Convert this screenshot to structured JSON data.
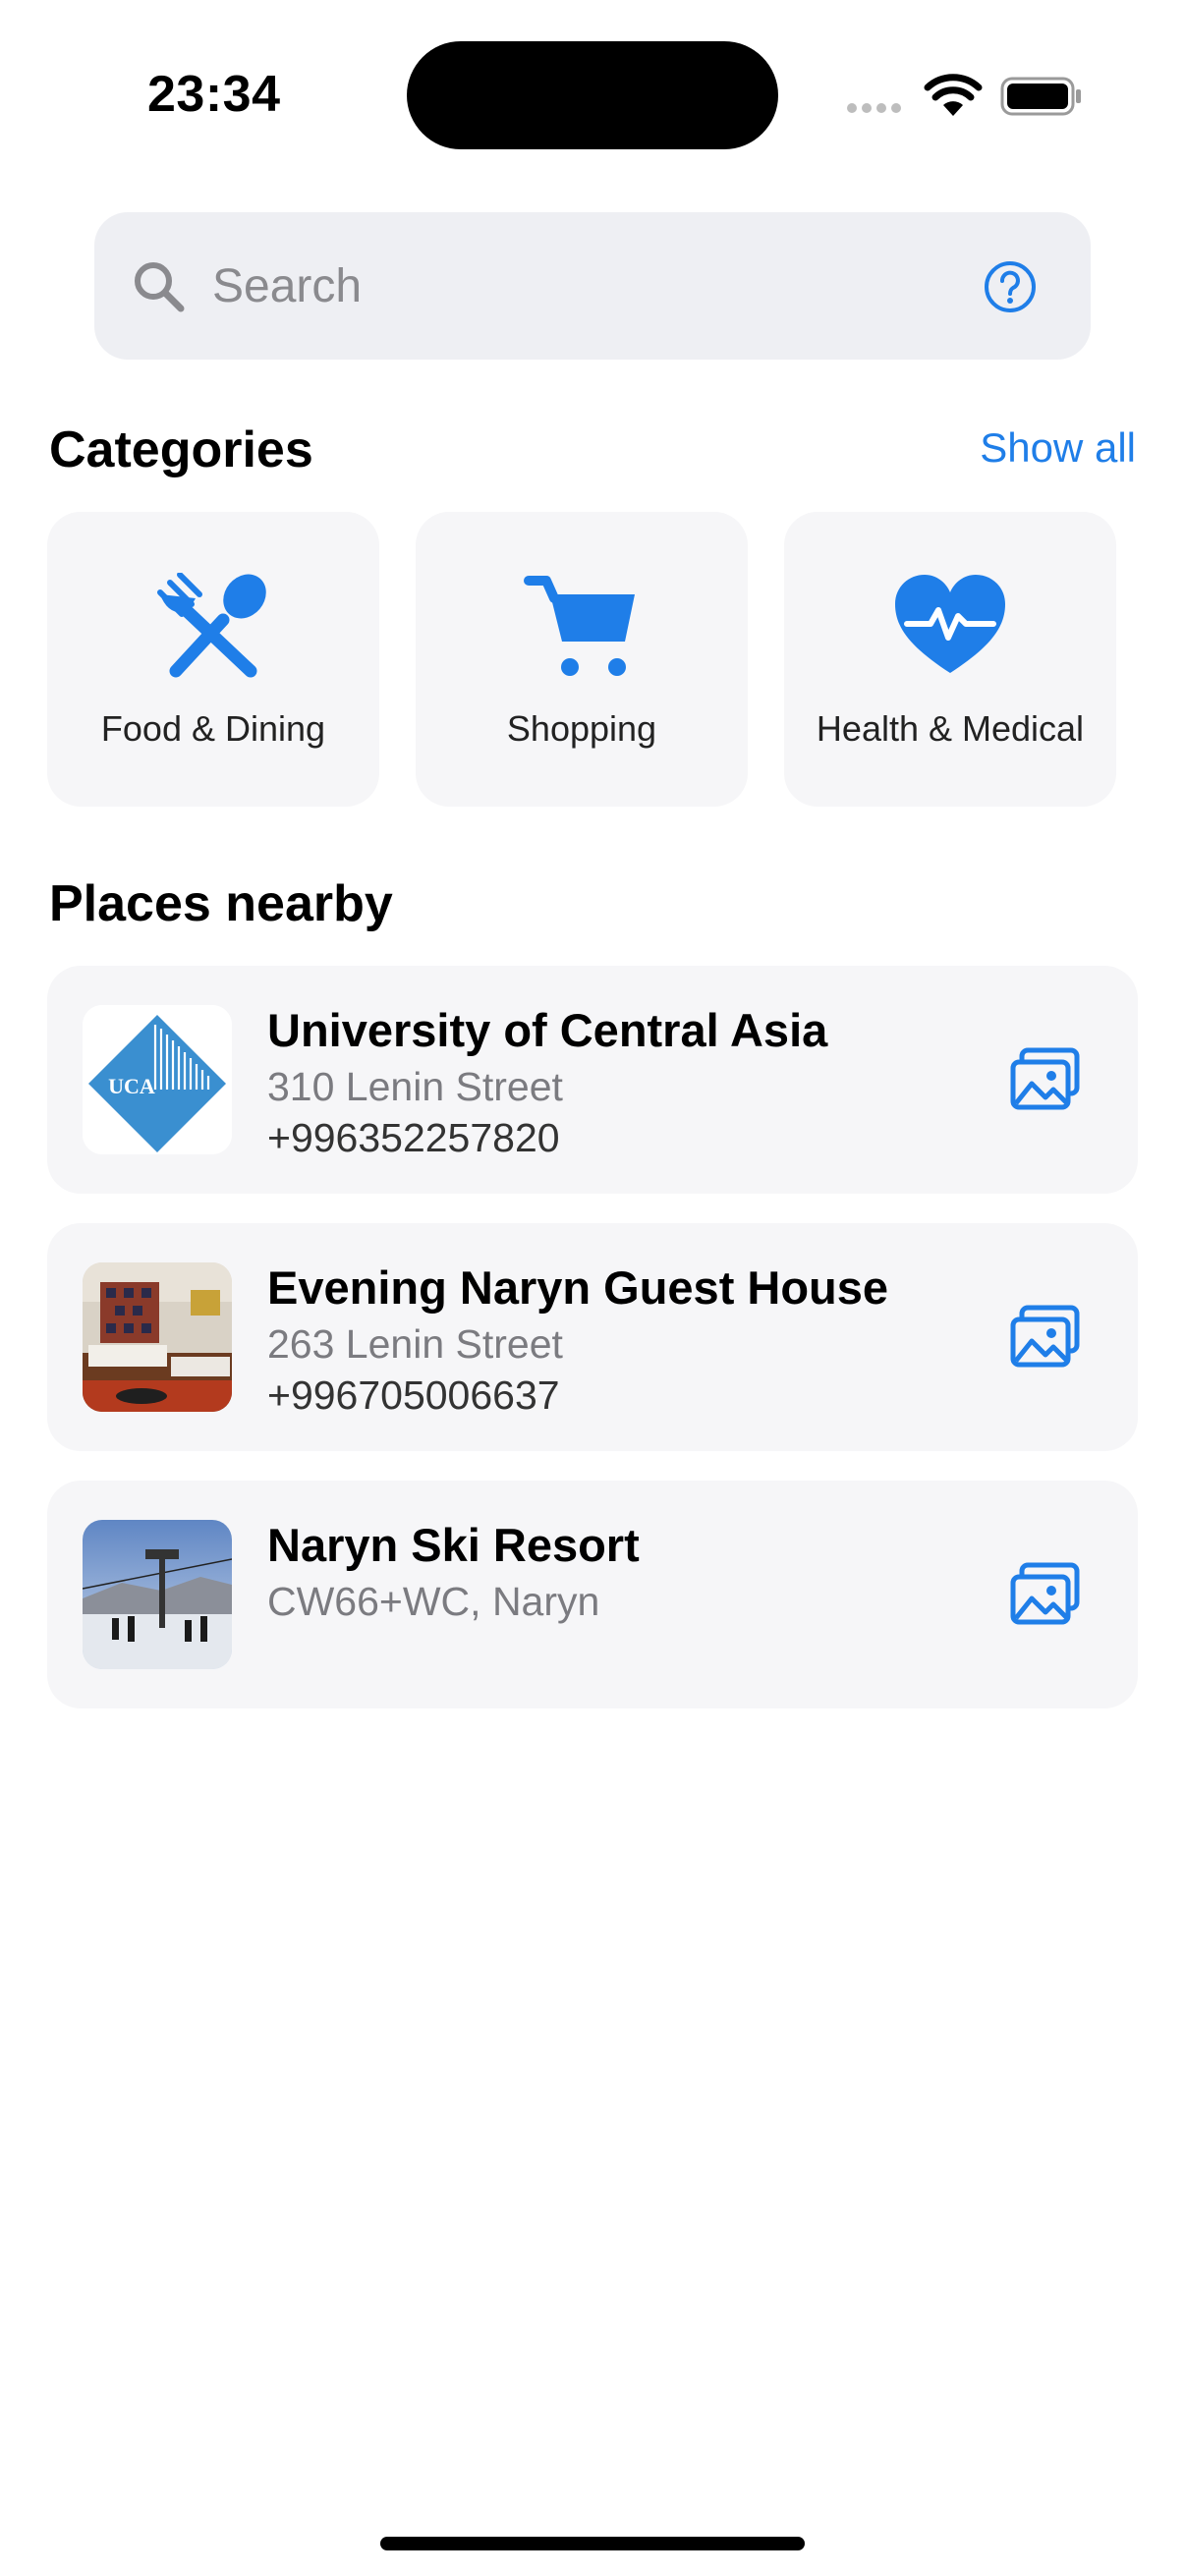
{
  "status_bar": {
    "time": "23:34"
  },
  "search": {
    "placeholder": "Search",
    "value": ""
  },
  "categories": {
    "title": "Categories",
    "show_all": "Show all",
    "items": [
      {
        "label": "Food & Dining",
        "icon": "fork-spoon-icon"
      },
      {
        "label": "Shopping",
        "icon": "cart-icon"
      },
      {
        "label": "Health & Medical",
        "icon": "heart-pulse-icon"
      }
    ]
  },
  "places": {
    "title": "Places nearby",
    "items": [
      {
        "name": "University of Central Asia",
        "address": "310 Lenin Street",
        "phone": "+996352257820",
        "logo_text": "UCA"
      },
      {
        "name": "Evening Naryn Guest House",
        "address": "263 Lenin Street",
        "phone": "+996705006637"
      },
      {
        "name": "Naryn Ski Resort",
        "address": "CW66+WC, Naryn",
        "phone": ""
      }
    ]
  },
  "colors": {
    "accent": "#1f7ee8",
    "card_bg": "#f6f6f8",
    "search_bg": "#eeeff3",
    "secondary_text": "#7b7b80"
  }
}
